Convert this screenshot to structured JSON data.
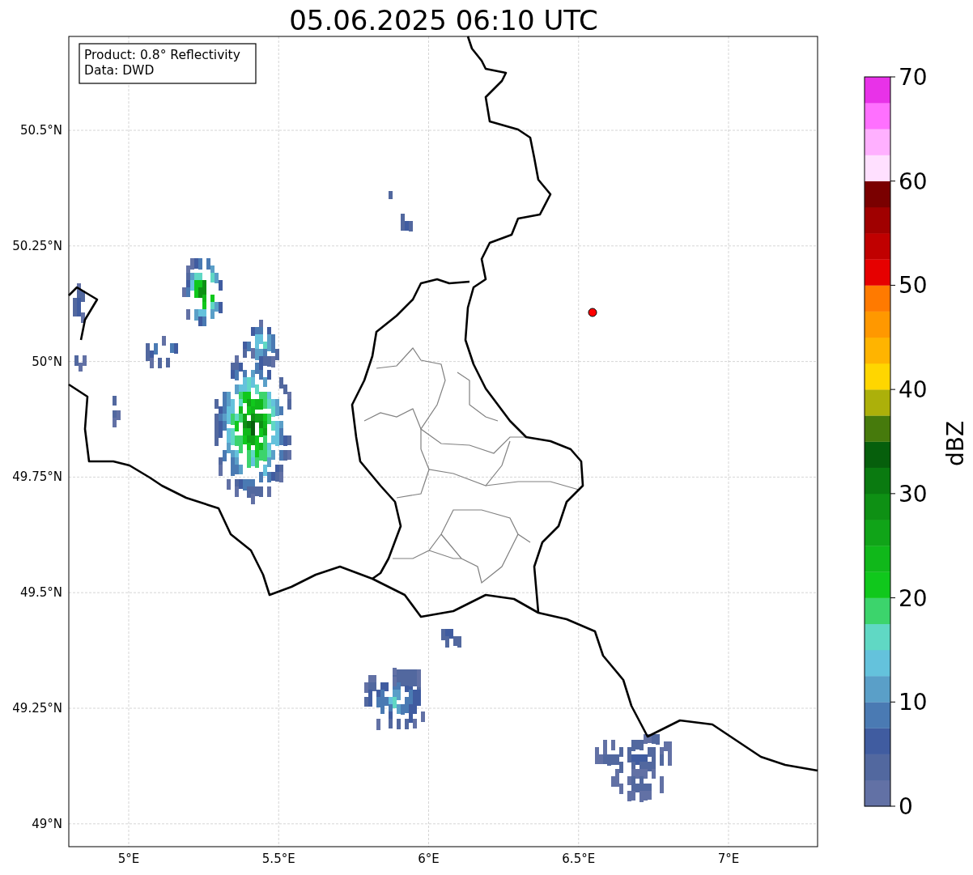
{
  "title": "05.06.2025 06:10 UTC",
  "info_box": {
    "lines": [
      "Product: 0.8° Reflectivity",
      "Data: DWD"
    ]
  },
  "map": {
    "yticks": [
      "50.5°N",
      "50.25°N",
      "50°N",
      "49.75°N",
      "49.5°N",
      "49.25°N",
      "49°N"
    ],
    "xticks": [
      "5°E",
      "5.5°E",
      "6°E",
      "6.5°E",
      "7°E"
    ]
  },
  "colorbar": {
    "label": "dBZ",
    "ticks": [
      "70",
      "60",
      "50",
      "40",
      "30",
      "20",
      "10",
      "0"
    ],
    "bands": [
      {
        "color": "#6271a5"
      },
      {
        "color": "#52689f"
      },
      {
        "color": "#405ca0"
      },
      {
        "color": "#4a7ab3"
      },
      {
        "color": "#5a9fc8"
      },
      {
        "color": "#64c2dc"
      },
      {
        "color": "#60d8c4"
      },
      {
        "color": "#3cd46c"
      },
      {
        "color": "#10c81c"
      },
      {
        "color": "#10b81a"
      },
      {
        "color": "#10a418"
      },
      {
        "color": "#0e9014"
      },
      {
        "color": "#0a7a10"
      },
      {
        "color": "#065f0c"
      },
      {
        "color": "#467a0c"
      },
      {
        "color": "#acb00a"
      },
      {
        "color": "#ffd600"
      },
      {
        "color": "#ffb400"
      },
      {
        "color": "#ff9800"
      },
      {
        "color": "#ff7a00"
      },
      {
        "color": "#e60000"
      },
      {
        "color": "#c00000"
      },
      {
        "color": "#a00000"
      },
      {
        "color": "#7a0000"
      },
      {
        "color": "#ffe0ff"
      },
      {
        "color": "#ffb0ff"
      },
      {
        "color": "#ff70ff"
      },
      {
        "color": "#e832e8"
      }
    ]
  }
}
